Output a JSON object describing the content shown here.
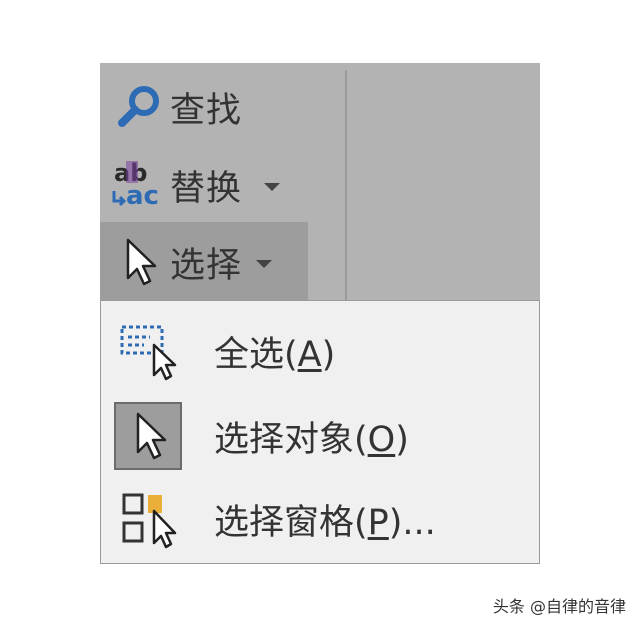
{
  "ribbon": {
    "find": {
      "label": "查找",
      "icon": "magnifier-icon"
    },
    "replace": {
      "label": "替换",
      "icon": "replace-abac-icon",
      "icon_text_top": "ab",
      "icon_text_bottom": "ac"
    },
    "select": {
      "label": "选择",
      "icon": "cursor-arrow-icon"
    }
  },
  "menu": {
    "items": [
      {
        "label_pre": "全选(",
        "accel": "A",
        "label_post": ")",
        "icon": "select-all-icon"
      },
      {
        "label_pre": "选择对象(",
        "accel": "O",
        "label_post": ")",
        "icon": "select-objects-icon"
      },
      {
        "label_pre": "选择窗格(",
        "accel": "P",
        "label_post": ")...",
        "icon": "selection-pane-icon"
      }
    ]
  },
  "watermark": {
    "text": "头条 @自律的音律"
  },
  "colors": {
    "ribbon_bg": "#b3b3b3",
    "ribbon_active": "#9d9d9d",
    "menu_bg": "#f0f0f0",
    "accent_blue": "#2d6bb5",
    "accent_purple": "#7b3fa0",
    "accent_orange": "#e8a317"
  }
}
